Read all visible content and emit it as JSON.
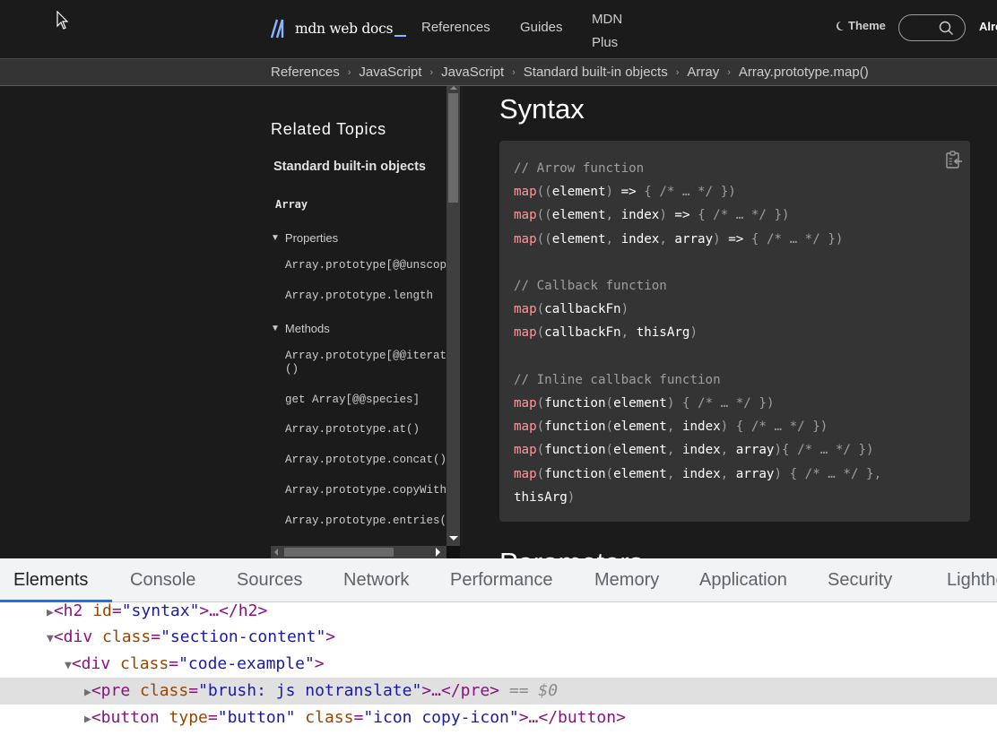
{
  "nav": {
    "logo_text": "mdn web docs",
    "links": [
      "References",
      "Guides",
      "MDN Plus"
    ],
    "theme_label": "Theme",
    "search_placeholder": "",
    "already_label": "Already a subscriber?"
  },
  "breadcrumb": [
    "References",
    "JavaScript",
    "JavaScript",
    "Standard built-in objects",
    "Array",
    "Array.prototype.map()"
  ],
  "sidebar": {
    "title": "Related Topics",
    "section": "Standard built-in objects",
    "object": "Array",
    "groups": [
      {
        "label": "Properties",
        "items": [
          "Array.prototype[@@unscopables]",
          "Array.prototype.length"
        ]
      },
      {
        "label": "Methods",
        "items": [
          "Array.prototype[@@iterator]()",
          "get Array[@@species]",
          "Array.prototype.at()",
          "Array.prototype.concat()",
          "Array.prototype.copyWithin()",
          "Array.prototype.entries()"
        ]
      }
    ],
    "display_items": {
      "p0": "Array.prototype[@@unscop",
      "p1": "Array.prototype.length",
      "m0": "Array.prototype[@@iterat\n()",
      "m1": "get Array[@@species]",
      "m2": "Array.prototype.at()",
      "m3": "Array.prototype.concat()",
      "m4": "Array.prototype.copyWith",
      "m5": "Array.prototype.entries("
    }
  },
  "main": {
    "heading": "Syntax",
    "next_heading": "Parameters",
    "copy_button_label": "Copy to Clipboard",
    "code_lines": [
      "// Arrow function",
      "map((element) => { /* … */ })",
      "map((element, index) => { /* … */ })",
      "map((element, index, array) => { /* … */ })",
      "",
      "// Callback function",
      "map(callbackFn)",
      "map(callbackFn, thisArg)",
      "",
      "// Inline callback function",
      "map(function(element) { /* … */ })",
      "map(function(element, index) { /* … */ })",
      "map(function(element, index, array){ /* … */ })",
      "map(function(element, index, array) { /* … */ },",
      "thisArg)"
    ]
  },
  "devtools": {
    "tabs": [
      "Elements",
      "Console",
      "Sources",
      "Network",
      "Performance",
      "Memory",
      "Application",
      "Security",
      "Lighthouse"
    ],
    "active_tab": "Elements",
    "dom_nodes": [
      {
        "expanded": false,
        "tag": "h2",
        "attrs": [
          [
            "id",
            "syntax"
          ]
        ],
        "selected": false
      },
      {
        "expanded": true,
        "tag": "div",
        "attrs": [
          [
            "class",
            "section-content"
          ]
        ],
        "selected": false
      },
      {
        "expanded": true,
        "tag": "div",
        "attrs": [
          [
            "class",
            "code-example"
          ]
        ],
        "selected": false
      },
      {
        "expanded": false,
        "tag": "pre",
        "attrs": [
          [
            "class",
            "brush: js notranslate"
          ]
        ],
        "selected": true,
        "marker": "== $0"
      },
      {
        "expanded": false,
        "tag": "button",
        "attrs": [
          [
            "type",
            "button"
          ],
          [
            "class",
            "icon copy-icon"
          ]
        ],
        "selected": false
      }
    ]
  },
  "colors": {
    "background": "#1b1b1b",
    "code_bg": "#343434",
    "code_function": "#ff97a0",
    "accent": "#8cb4ff",
    "devtools_active": "#1a73e8"
  }
}
